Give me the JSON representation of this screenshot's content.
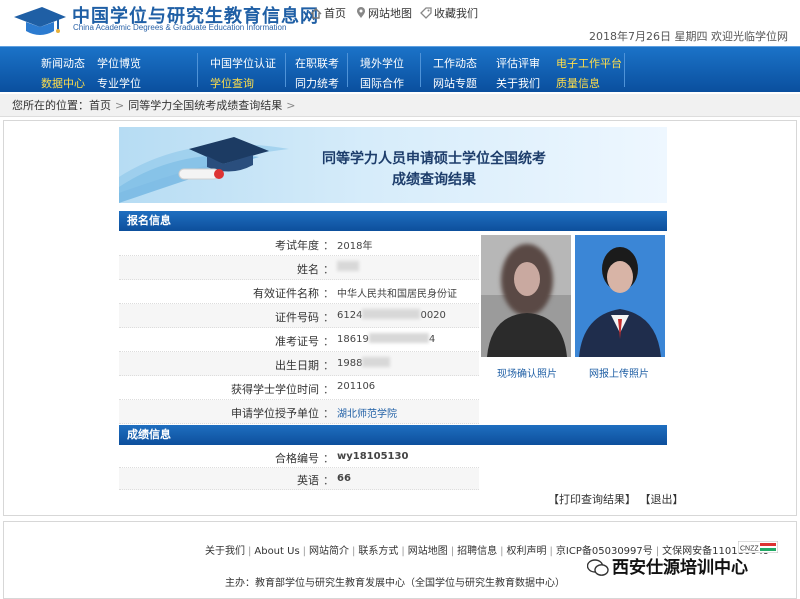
{
  "header": {
    "site_title": "中国学位与研究生教育信息网",
    "site_subtitle": "China Academic Degrees & Graduate Education Information",
    "links": {
      "home": "首页",
      "sitemap": "网站地图",
      "favorite": "收藏我们"
    },
    "date_line": "2018年7月26日 星期四  欢迎光临学位网"
  },
  "nav": [
    {
      "top": "新闻动态",
      "bottom": "数据中心",
      "top_hl": false,
      "bottom_hl": true
    },
    {
      "top": "学位博览",
      "bottom": "专业学位",
      "top_hl": false,
      "bottom_hl": false
    },
    {
      "top": "中国学位认证",
      "bottom": "学位查询",
      "top_hl": false,
      "bottom_hl": true
    },
    {
      "top": "在职联考",
      "bottom": "同力统考",
      "top_hl": false,
      "bottom_hl": false
    },
    {
      "top": "境外学位",
      "bottom": "国际合作",
      "top_hl": false,
      "bottom_hl": false
    },
    {
      "top": "工作动态",
      "bottom": "网站专题",
      "top_hl": false,
      "bottom_hl": false
    },
    {
      "top": "评估评审",
      "bottom": "关于我们",
      "top_hl": false,
      "bottom_hl": false
    },
    {
      "top": "电子工作平台",
      "bottom": "质量信息",
      "top_hl": true,
      "bottom_hl": true
    }
  ],
  "breadcrumb": {
    "prefix": "您所在的位置：",
    "home": "首页",
    "current": "同等学力全国统考成绩查询结果"
  },
  "banner": {
    "title_line1": "同等学力人员申请硕士学位全国统考",
    "title_line2": "成绩查询结果"
  },
  "registration": {
    "heading": "报名信息",
    "rows": [
      {
        "label": "考试年度",
        "value": "2018年"
      },
      {
        "label": "姓名",
        "value": ""
      },
      {
        "label": "有效证件名称",
        "value": "中华人民共和国居民身份证"
      },
      {
        "label": "证件号码",
        "value_start": "6124",
        "value_end": "0020"
      },
      {
        "label": "准考证号",
        "value_start": "18619",
        "value_end": "4"
      },
      {
        "label": "出生日期",
        "value_start": "1988",
        "value_end": ""
      },
      {
        "label": "获得学士学位时间",
        "value": "201106"
      },
      {
        "label": "申请学位授予单位",
        "value": "湖北师范学院"
      }
    ],
    "photos": {
      "onsite_caption": "现场确认照片",
      "online_caption": "网报上传照片"
    }
  },
  "scores": {
    "heading": "成绩信息",
    "rows": [
      {
        "label": "合格编号",
        "value": "wy18105130"
      },
      {
        "label": "英语",
        "value": "66"
      }
    ]
  },
  "actions": {
    "print": "【打印查询结果】",
    "exit": "【退出】"
  },
  "footer": {
    "links": [
      "关于我们",
      "About Us",
      "网站简介",
      "联系方式",
      "网站地图",
      "招聘信息",
      "权利声明",
      "京ICP备05030997号",
      "文保网安备110180049"
    ],
    "host": "主办：教育部学位与研究生教育发展中心（全国学位与研究生教育数据中心）",
    "watermark": "西安仕源培训中心"
  },
  "colors": {
    "brand_blue": "#1f5fa5",
    "nav_highlight": "#ffde4a",
    "section_blue": "#0d4f9c"
  }
}
